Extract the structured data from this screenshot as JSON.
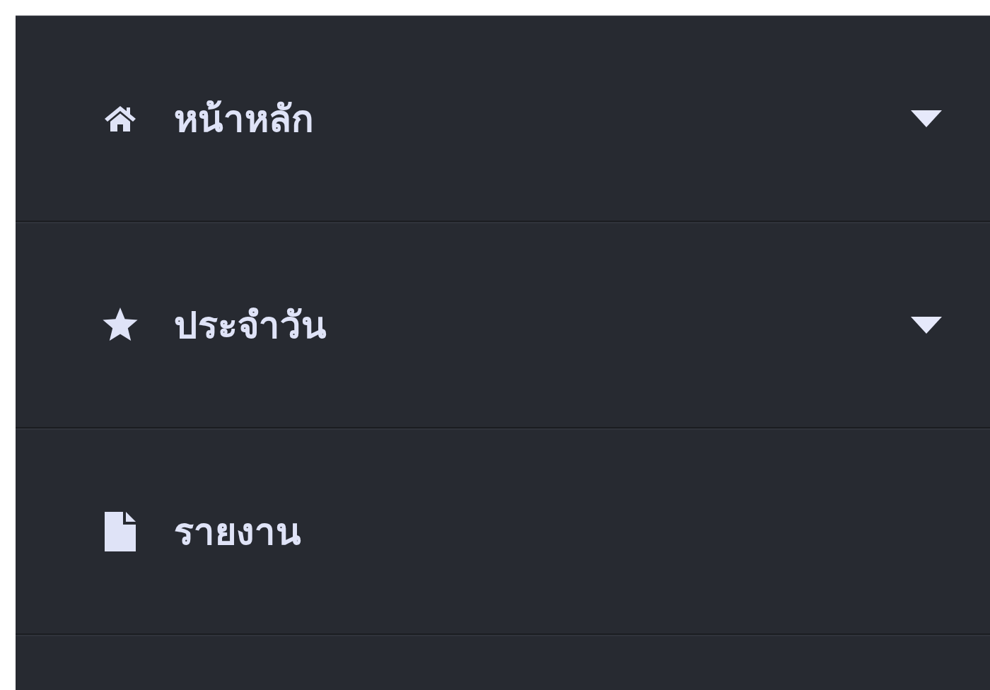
{
  "menu": [
    {
      "label": "หน้าหลัก",
      "has_submenu": true
    },
    {
      "label": "ประจำวัน",
      "has_submenu": true
    },
    {
      "label": "รายงาน",
      "has_submenu": false
    }
  ]
}
